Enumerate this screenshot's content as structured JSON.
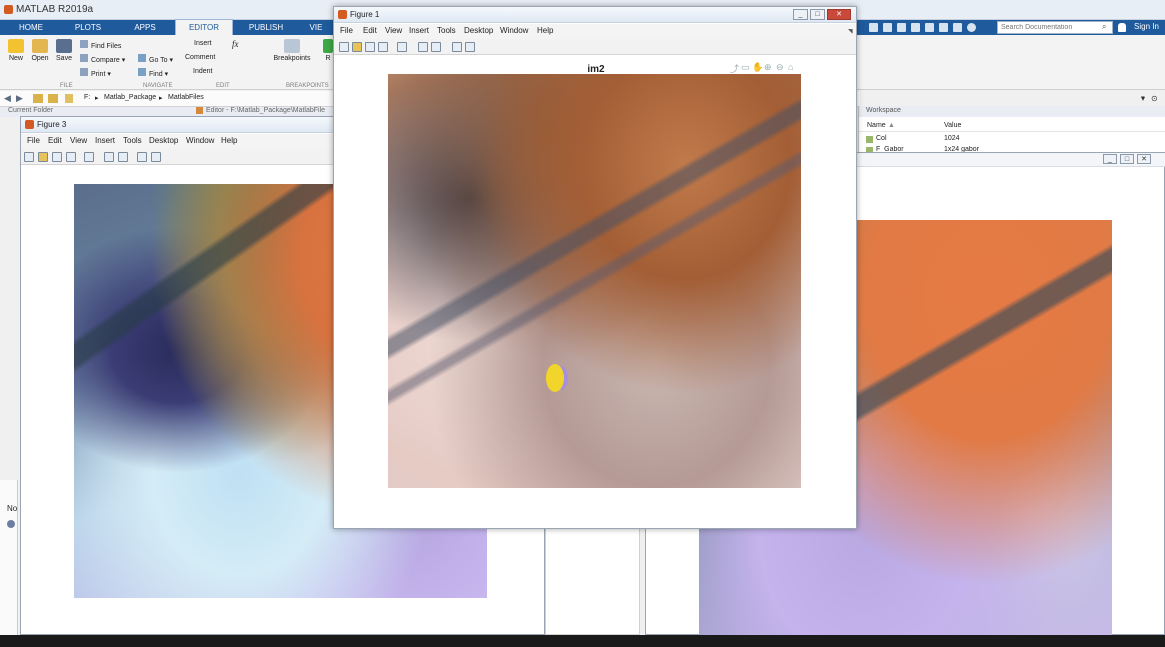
{
  "app": {
    "title": "MATLAB R2019a"
  },
  "tabs": [
    {
      "label": "HOME"
    },
    {
      "label": "PLOTS"
    },
    {
      "label": "APPS"
    },
    {
      "label": "EDITOR"
    },
    {
      "label": "PUBLISH"
    },
    {
      "label": "VIE"
    }
  ],
  "ribbon": {
    "new": "New",
    "open": "Open",
    "save": "Save",
    "find_files": "Find Files",
    "compare": "Compare",
    "print": "Print",
    "go_to": "Go To",
    "find": "Find",
    "insert": "Insert",
    "comment": "Comment",
    "indent": "Indent",
    "fx": "fx",
    "breakpoints": "Breakpoints",
    "run_partial": "R",
    "groups": {
      "file": "FILE",
      "navigate": "NAVIGATE",
      "edit": "EDIT",
      "breakpoints": "BREAKPOINTS"
    }
  },
  "address": {
    "parts": [
      "F:",
      "Matlab_Package",
      "MatlabFiles"
    ],
    "current_folder": "Current Folder",
    "editor_path": "Editor - F:\\Matlab_Package\\MatlabFile"
  },
  "doc": {
    "search_placeholder": "Search Documentation",
    "sign_in": "Sign In"
  },
  "workspace": {
    "title": "Workspace",
    "col_name": "Name",
    "col_value": "Value",
    "rows": [
      {
        "name": "Col",
        "value": "1024"
      },
      {
        "name": "F_Gabor",
        "value": "1x24 gabor"
      }
    ]
  },
  "figure1": {
    "title": "Figure 1",
    "menus": [
      "File",
      "Edit",
      "View",
      "Insert",
      "Tools",
      "Desktop",
      "Window",
      "Help"
    ],
    "axes_title": "im2"
  },
  "figure3": {
    "title": "Figure 3",
    "menus": [
      "File",
      "Edit",
      "View",
      "Insert",
      "Tools",
      "Desktop",
      "Window",
      "Help"
    ]
  },
  "left_edge": {
    "label": "No"
  },
  "colors": {
    "tab_blue": "#1e5a9c",
    "close_red": "#c94a3b",
    "marker_yellow": "#f1d52b"
  }
}
